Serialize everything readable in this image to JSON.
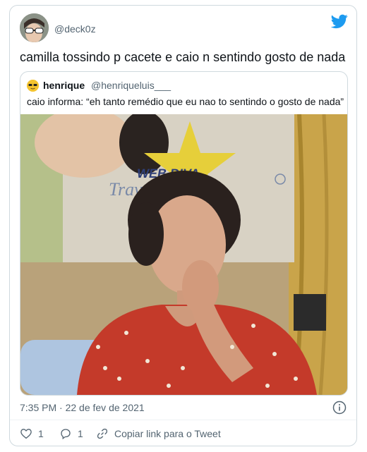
{
  "tweet": {
    "handle": "@deck0z",
    "text": "camilla tossindo p cacete e caio n sentindo gosto de nada",
    "timestamp": "7:35 PM · 22 de fev de 2021"
  },
  "quoted": {
    "name": "henrique",
    "handle": "@henriqueluis___",
    "text": "caio informa: “eh tanto remédio que eu nao to sentindo o gosto de nada”"
  },
  "actions": {
    "likes": "1",
    "replies": "1",
    "copy_link": "Copiar link para o Tweet"
  },
  "icons": {
    "brand": "twitter-bird-icon",
    "info": "info-icon",
    "like": "heart-icon",
    "reply": "reply-icon",
    "link": "link-icon"
  },
  "colors": {
    "brand": "#1d9bf0",
    "secondary_text": "#536471",
    "border": "#cfd9de"
  }
}
